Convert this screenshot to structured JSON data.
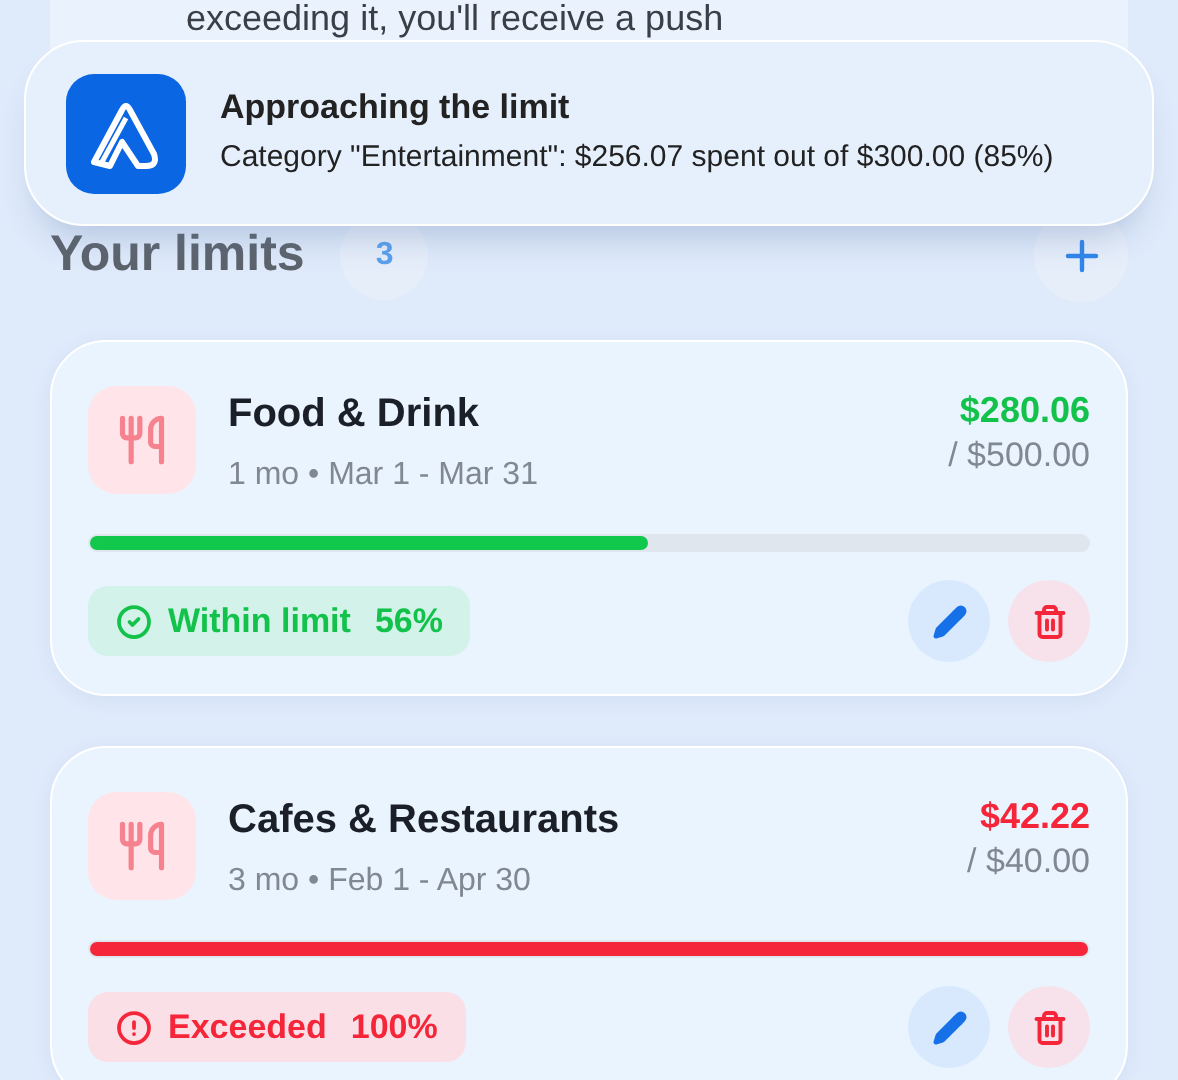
{
  "background_card": {
    "text": "exceeding it, you'll receive a push"
  },
  "notification": {
    "title": "Approaching the limit",
    "body": "Category \"Entertainment\": $256.07 spent out of $300.00 (85%)"
  },
  "section": {
    "title": "Your limits",
    "count": "3"
  },
  "limits": [
    {
      "name": "Food & Drink",
      "period": "1 mo • Mar 1 - Mar 31",
      "spent": "$280.06",
      "limit": "/ $500.00",
      "level": 0.56,
      "kind": "within",
      "status_label": "Within limit",
      "percent": "56%"
    },
    {
      "name": "Cafes & Restaurants",
      "period": "3 mo • Feb 1 - Apr 30",
      "spent": "$42.22",
      "limit": "/ $40.00",
      "level": 1,
      "kind": "exceeded",
      "status_label": "Exceeded",
      "percent": "100%"
    }
  ]
}
